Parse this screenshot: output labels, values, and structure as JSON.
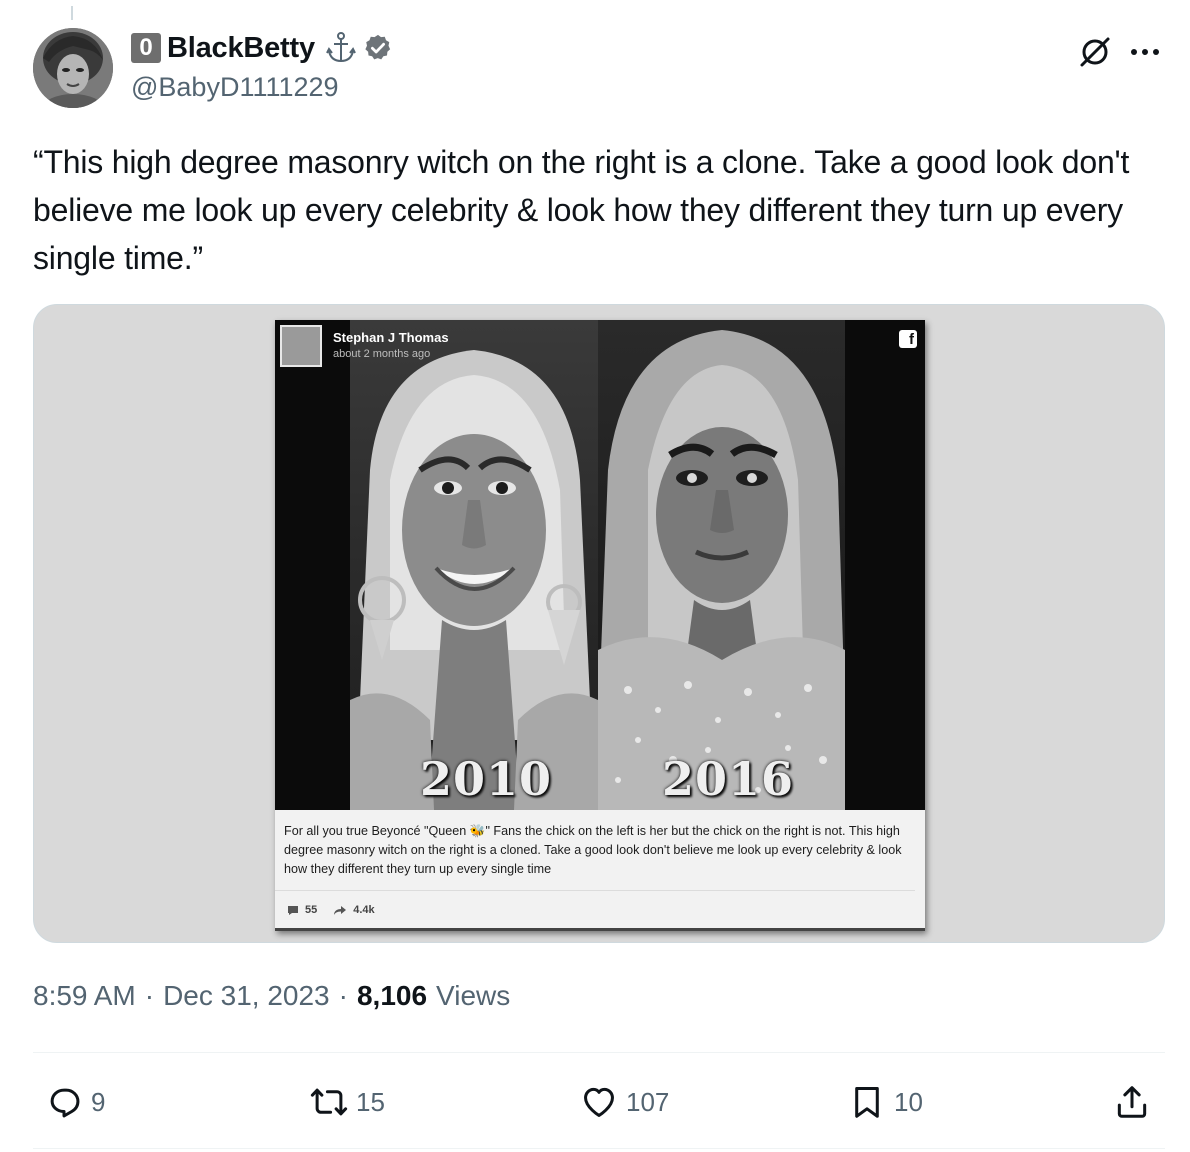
{
  "author": {
    "badge": "0",
    "display_name": "BlackBetty",
    "handle": "@BabyD1111229"
  },
  "tweet": {
    "text": "“This high degree masonry witch on the right is a clone. Take a good look don't believe me look up every celebrity & look how they different they turn up every single time.”"
  },
  "media": {
    "fb_poster_name": "Stephan J Thomas",
    "fb_post_time": "about 2 months ago",
    "left_year": "2010",
    "right_year": "2016",
    "fb_caption": "For all you true Beyoncé \"Queen 🐝\" Fans the chick on the left is her but the chick on the right is not. This high degree masonry witch on the right is a cloned. Take a good look don't believe me look up every celebrity & look how they different they turn up every single time",
    "fb_comments": "55",
    "fb_shares": "4.4k"
  },
  "meta": {
    "time": "8:59 AM",
    "separator": "·",
    "date": "Dec 31, 2023",
    "views_count": "8,106",
    "views_label": "Views"
  },
  "actions": {
    "replies": "9",
    "reposts": "15",
    "likes": "107",
    "bookmarks": "10"
  },
  "icons": {
    "badge": "anchor-icon",
    "verified": "verified-badge-icon",
    "grok": "grok-icon",
    "more": "more-icon",
    "reply": "reply-icon",
    "repost": "repost-icon",
    "like": "heart-icon",
    "bookmark": "bookmark-icon",
    "share": "share-icon"
  },
  "colors": {
    "text_primary": "#0f1419",
    "text_secondary": "#536471",
    "border": "#eff3f4"
  }
}
